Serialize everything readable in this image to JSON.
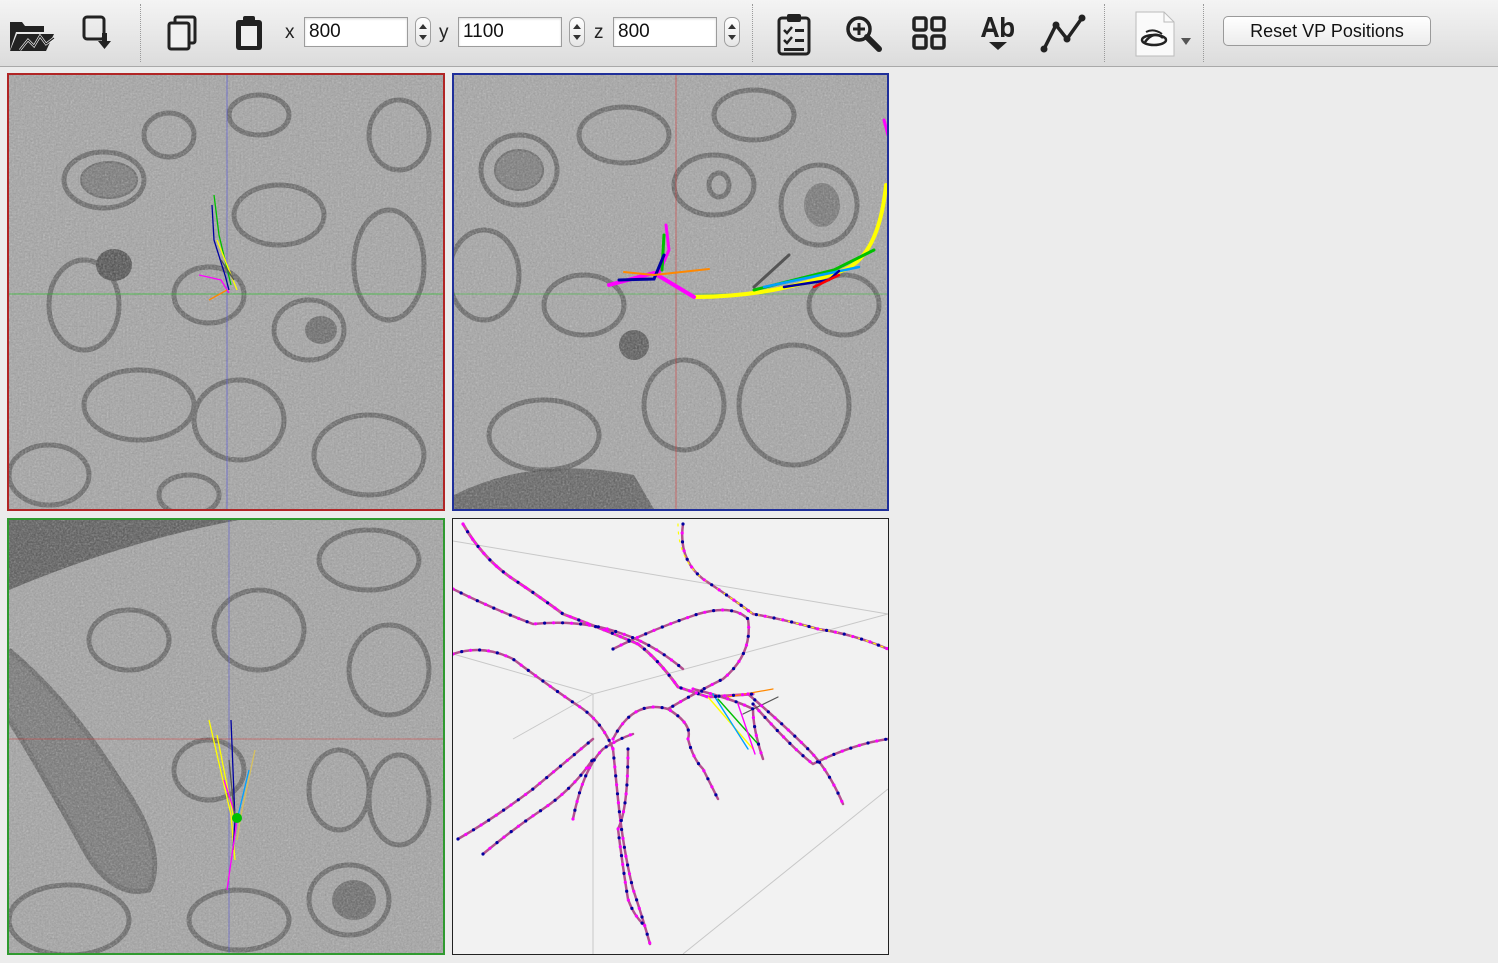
{
  "toolbar": {
    "icons": [
      "open-folder-icon",
      "save-icon",
      "copy-icon",
      "paste-icon",
      "clipboard-icon",
      "zoom-icon",
      "grid-icon",
      "text-size-icon",
      "skeleton-icon",
      "tools-icon"
    ],
    "coords": {
      "x_label": "x",
      "x_value": "800",
      "y_label": "y",
      "y_value": "1100",
      "z_label": "z",
      "z_value": "800"
    },
    "reset_label": "Reset VP Positions"
  },
  "viewports": {
    "xy": {
      "border_color": "#b12525"
    },
    "xz": {
      "border_color": "#1f2f9a"
    },
    "yz": {
      "border_color": "#2f9a2f"
    },
    "skeleton_3d": {
      "border_color": "#222222"
    }
  },
  "colors": {
    "background": "#ececec",
    "tracing": [
      "#ff00ff",
      "#ffff00",
      "#00c000",
      "#0000a0",
      "#00a0ff",
      "#ff0000",
      "#ff8800",
      "#555555"
    ]
  }
}
